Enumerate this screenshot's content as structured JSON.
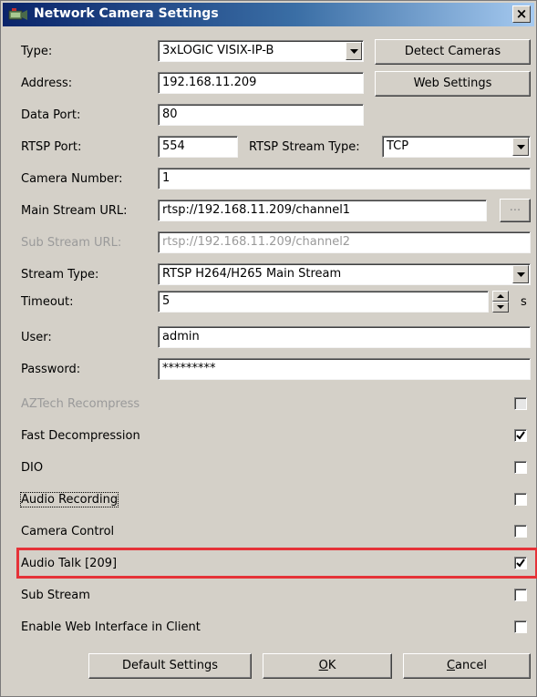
{
  "window": {
    "title": "Network Camera Settings",
    "close_glyph": "×",
    "icon": "network-camera-icon"
  },
  "fields": {
    "type": {
      "label": "Type:",
      "value": "3xLOGIC VISIX-IP-B"
    },
    "address": {
      "label": "Address:",
      "value": "192.168.11.209"
    },
    "data_port": {
      "label": "Data Port:",
      "value": "80"
    },
    "rtsp_port": {
      "label": "RTSP Port:",
      "value": "554"
    },
    "rtsp_stream_type": {
      "label": "RTSP Stream Type:",
      "value": "TCP"
    },
    "camera_number": {
      "label": "Camera Number:",
      "value": "1"
    },
    "main_stream_url": {
      "label": "Main Stream URL:",
      "value": "rtsp://192.168.11.209/channel1",
      "browse": "..."
    },
    "sub_stream_url": {
      "label": "Sub Stream URL:",
      "value": "rtsp://192.168.11.209/channel2"
    },
    "stream_type": {
      "label": "Stream Type:",
      "value": "RTSP H264/H265 Main Stream"
    },
    "timeout": {
      "label": "Timeout:",
      "value": "5",
      "unit": "s"
    },
    "user": {
      "label": "User:",
      "value": "admin"
    },
    "password": {
      "label": "Password:",
      "value": "*********"
    }
  },
  "buttons": {
    "detect_cameras": "Detect Cameras",
    "web_settings": "Web Settings",
    "default_settings": "Default Settings",
    "ok_mnemonic": "O",
    "ok_rest": "K",
    "cancel_mnemonic": "C",
    "cancel_rest": "ancel"
  },
  "checkboxes": [
    {
      "label": "AZTech Recompress",
      "checked": false,
      "disabled": true
    },
    {
      "label": "Fast Decompression",
      "checked": true,
      "disabled": false
    },
    {
      "label": "DIO",
      "checked": false,
      "disabled": false
    },
    {
      "label": "Audio Recording",
      "checked": false,
      "disabled": false
    },
    {
      "label": "Camera Control",
      "checked": false,
      "disabled": false
    },
    {
      "label": "Audio Talk [209]",
      "checked": true,
      "disabled": false
    },
    {
      "label": "Sub Stream",
      "checked": false,
      "disabled": false
    },
    {
      "label": "Enable Web Interface in Client",
      "checked": false,
      "disabled": false
    }
  ],
  "colors": {
    "dialog_bg": "#d4d0c8",
    "title_gradient_start": "#0a246a",
    "highlight_border": "#e53238",
    "disabled_text": "#9a9a9a"
  }
}
